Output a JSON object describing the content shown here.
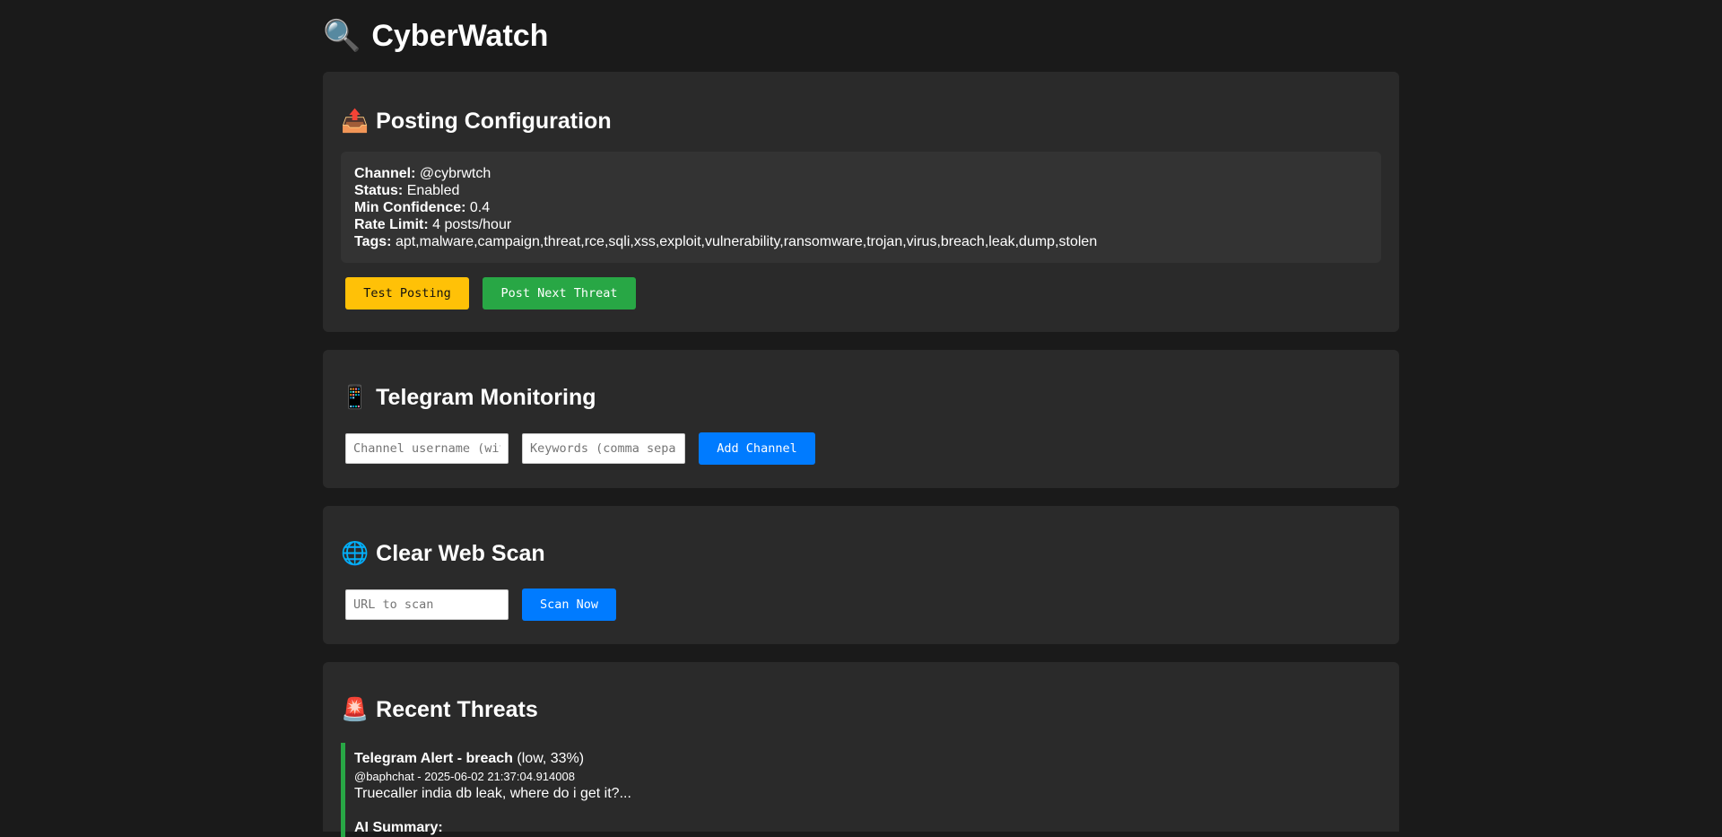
{
  "app": {
    "title": "CyberWatch",
    "logo_glyph": "🔍",
    "logo_icon": "magnifier-icon"
  },
  "posting": {
    "title": "Posting Configuration",
    "glyph": "📤",
    "icon": "outbox-tray-icon",
    "channel_label": "Channel:",
    "channel_value": "@cybrwtch",
    "status_label": "Status:",
    "status_value": "Enabled",
    "confidence_label": "Min Confidence:",
    "confidence_value": "0.4",
    "rate_label": "Rate Limit:",
    "rate_value": "4 posts/hour",
    "tags_label": "Tags:",
    "tags_value": "apt,malware,campaign,threat,rce,sqli,xss,exploit,vulnerability,ransomware,trojan,virus,breach,leak,dump,stolen",
    "test_button": "Test Posting",
    "post_button": "Post Next Threat"
  },
  "telegram": {
    "title": "Telegram Monitoring",
    "glyph": "📱",
    "icon": "mobile-phone-icon",
    "channel_placeholder": "Channel username (without @)",
    "keywords_placeholder": "Keywords (comma separated)",
    "add_button": "Add Channel"
  },
  "webscan": {
    "title": "Clear Web Scan",
    "glyph": "🌐",
    "icon": "globe-icon",
    "url_placeholder": "URL to scan",
    "scan_button": "Scan Now"
  },
  "threats": {
    "title": "Recent Threats",
    "glyph": "🚨",
    "icon": "siren-icon",
    "accent_color": "#28a745",
    "items": [
      {
        "title": "Telegram Alert - breach",
        "severity": "(low, 33%)",
        "meta": "@baphchat - 2025-06-02 21:37:04.914008",
        "text": "Truecaller india db leak, where do i get it?...",
        "summary_label": "AI Summary:"
      }
    ]
  },
  "colors": {
    "background": "#1a1a1a",
    "card": "#2a2a2a",
    "config_box": "#333333",
    "yellow_button": "#ffc107",
    "green_button": "#28a745",
    "blue_button": "#007bff"
  }
}
